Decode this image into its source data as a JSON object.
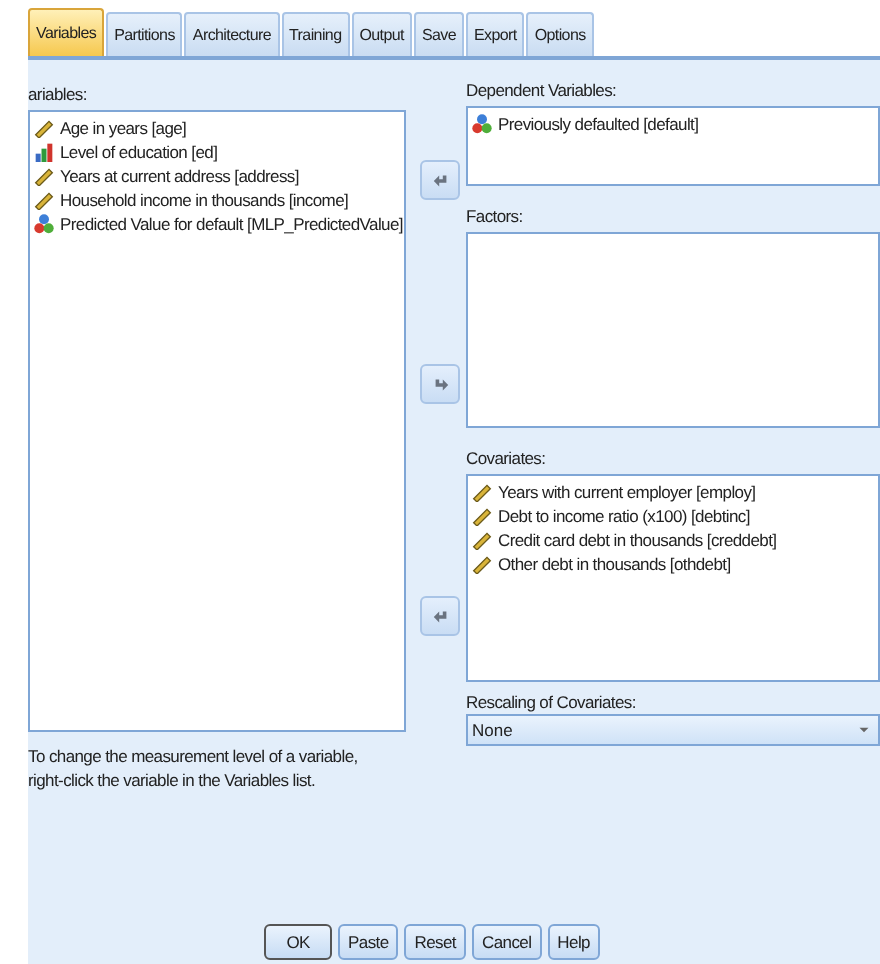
{
  "tabs": [
    {
      "label": "Variables",
      "selected": true
    },
    {
      "label": "Partitions",
      "selected": false
    },
    {
      "label": "Architecture",
      "selected": false
    },
    {
      "label": "Training",
      "selected": false
    },
    {
      "label": "Output",
      "selected": false
    },
    {
      "label": "Save",
      "selected": false
    },
    {
      "label": "Export",
      "selected": false
    },
    {
      "label": "Options",
      "selected": false
    }
  ],
  "variables": {
    "label": "ariables:",
    "items": [
      {
        "name": "Age in years [age]",
        "kind": "scale"
      },
      {
        "name": "Level of education [ed]",
        "kind": "ordinal"
      },
      {
        "name": "Years at current address [address]",
        "kind": "scale"
      },
      {
        "name": "Household income in thousands [income]",
        "kind": "scale"
      },
      {
        "name": "Predicted Value for default [MLP_PredictedValue]",
        "kind": "nominal"
      }
    ]
  },
  "dependent": {
    "label": "Dependent Variables:",
    "items": [
      {
        "name": "Previously defaulted [default]",
        "kind": "nominal"
      }
    ]
  },
  "factors": {
    "label": "Factors:"
  },
  "covariates": {
    "label": "Covariates:",
    "items": [
      {
        "name": "Years with current employer [employ]",
        "kind": "scale"
      },
      {
        "name": "Debt to income ratio (x100) [debtinc]",
        "kind": "scale"
      },
      {
        "name": "Credit card debt in thousands [creddebt]",
        "kind": "scale"
      },
      {
        "name": "Other debt in thousands [othdebt]",
        "kind": "scale"
      }
    ]
  },
  "note": "To change the measurement level of a variable, right-click the variable in the Variables list.",
  "rescaling": {
    "label": "Rescaling of Covariates:",
    "value": "None"
  },
  "buttons": [
    "OK",
    "Paste",
    "Reset",
    "Cancel",
    "Help"
  ]
}
